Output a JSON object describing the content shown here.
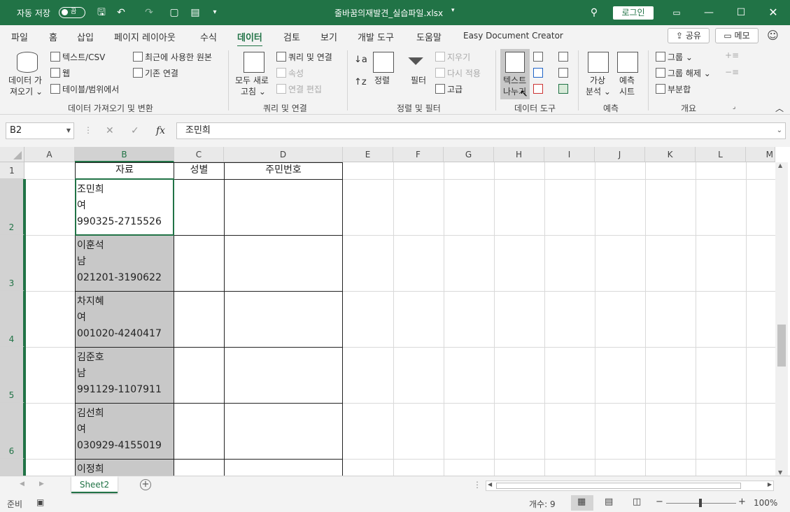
{
  "titlebar": {
    "autosave_label": "자동 저장",
    "autosave_state": "끔",
    "filename": "줄바꿈의재발견_실습파일.xlsx",
    "login": "로그인"
  },
  "tabs": [
    "파일",
    "홈",
    "삽입",
    "페이지 레이아웃",
    "수식",
    "데이터",
    "검토",
    "보기",
    "개발 도구",
    "도움말",
    "Easy Document Creator"
  ],
  "active_tab": "데이터",
  "share": "공유",
  "memo": "메모",
  "ribbon": {
    "get_data": [
      "데이터 가",
      "져오기"
    ],
    "text_csv": "텍스트/CSV",
    "web": "웹",
    "table_range": "테이블/범위에서",
    "recent_sources": "최근에 사용한 원본",
    "existing_conn": "기존 연결",
    "group1": "데이터 가져오기 및 변환",
    "refresh_all": [
      "모두 새로",
      "고침"
    ],
    "queries_conn": "쿼리 및 연결",
    "properties": "속성",
    "edit_links": "연결 편집",
    "group2": "쿼리 및 연결",
    "sort": "정렬",
    "filter": "필터",
    "clear": "지우기",
    "reapply": "다시 적용",
    "advanced": "고급",
    "group3": "정렬 및 필터",
    "text_to_columns": [
      "텍스트",
      "나누기"
    ],
    "group4": "데이터 도구",
    "what_if": [
      "가상",
      "분석"
    ],
    "forecast_sheet": [
      "예측",
      "시트"
    ],
    "group5": "예측",
    "group_btn": "그룹",
    "ungroup": "그룹 해제",
    "subtotal": "부분합",
    "group6": "개요"
  },
  "formula_bar": {
    "name_box": "B2",
    "fx": "fx",
    "content": "조민희"
  },
  "columns": [
    "A",
    "B",
    "C",
    "D",
    "E",
    "F",
    "G",
    "H",
    "I",
    "J",
    "K",
    "L",
    "M"
  ],
  "rows": [
    "1",
    "2",
    "3",
    "4",
    "5",
    "6"
  ],
  "header_row": {
    "b": "자료",
    "c": "성별",
    "d": "주민번호"
  },
  "records": [
    {
      "name": "조민희",
      "gender": "여",
      "id": "990325-2715526"
    },
    {
      "name": "이훈석",
      "gender": "남",
      "id": "021201-3190622"
    },
    {
      "name": "차지혜",
      "gender": "여",
      "id": "001020-4240417"
    },
    {
      "name": "김준호",
      "gender": "남",
      "id": "991129-1107911"
    },
    {
      "name": "김선희",
      "gender": "여",
      "id": "030929-4155019"
    },
    {
      "name": "이정희"
    }
  ],
  "sheet": "Sheet2",
  "status": {
    "ready": "준비",
    "count": "개수: 9",
    "zoom": "100%"
  }
}
